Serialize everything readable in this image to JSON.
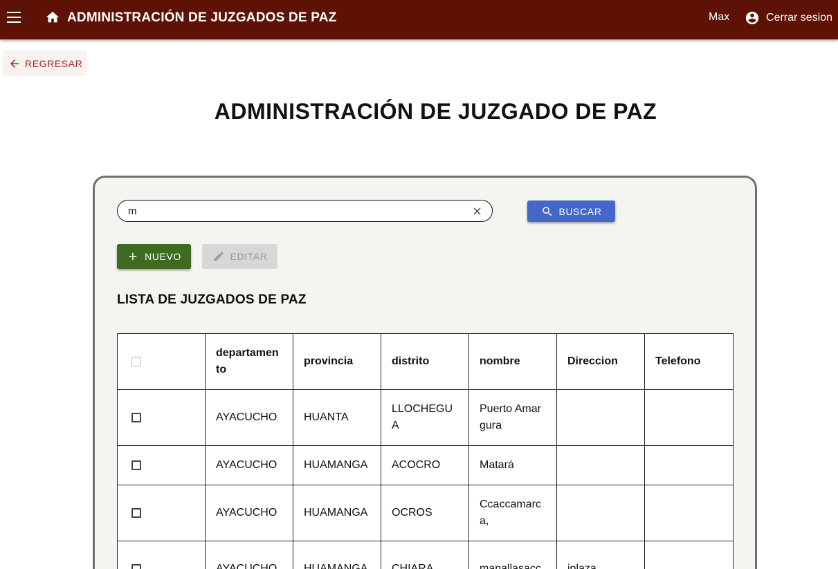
{
  "topbar": {
    "title": "ADMINISTRACIÓN DE JUZGADOS DE PAZ",
    "user": "Max",
    "logout_label": "Cerrar sesion",
    "background": "#5e1205"
  },
  "back_button": {
    "label": "REGRESAR"
  },
  "page_title": "ADMINISTRACIÓN DE JUZGADO DE PAZ",
  "search": {
    "value": "m",
    "button_label": "BUSCAR"
  },
  "actions": {
    "new_label": "NUEVO",
    "edit_label": "EDITAR"
  },
  "list_title": "LISTA DE JUZGADOS DE PAZ",
  "table": {
    "headers": [
      "departamento",
      "provincia",
      "distrito",
      "nombre",
      "Direccion",
      "Telefono"
    ],
    "rows": [
      [
        "AYACUCHO",
        "HUANTA",
        "LLOCHEGUA",
        "Puerto Amargura",
        "",
        ""
      ],
      [
        "AYACUCHO",
        "HUAMANGA",
        "ACOCRO",
        "Matará",
        "",
        ""
      ],
      [
        "AYACUCHO",
        "HUAMANGA",
        "OCROS",
        "Ccaccamarca,",
        "",
        ""
      ],
      [
        "AYACUCHO",
        "HUAMANGA",
        "CHIARA",
        "manallasacc",
        "jplaza",
        ""
      ]
    ]
  },
  "colors": {
    "primary_button": "#4467c9",
    "new_button": "#3e6b22",
    "back_text": "#a4261c"
  },
  "icons": [
    "menu-icon",
    "home-icon",
    "account-circle-icon",
    "arrow-left-icon",
    "close-icon",
    "search-icon",
    "plus-icon",
    "pencil-icon"
  ]
}
